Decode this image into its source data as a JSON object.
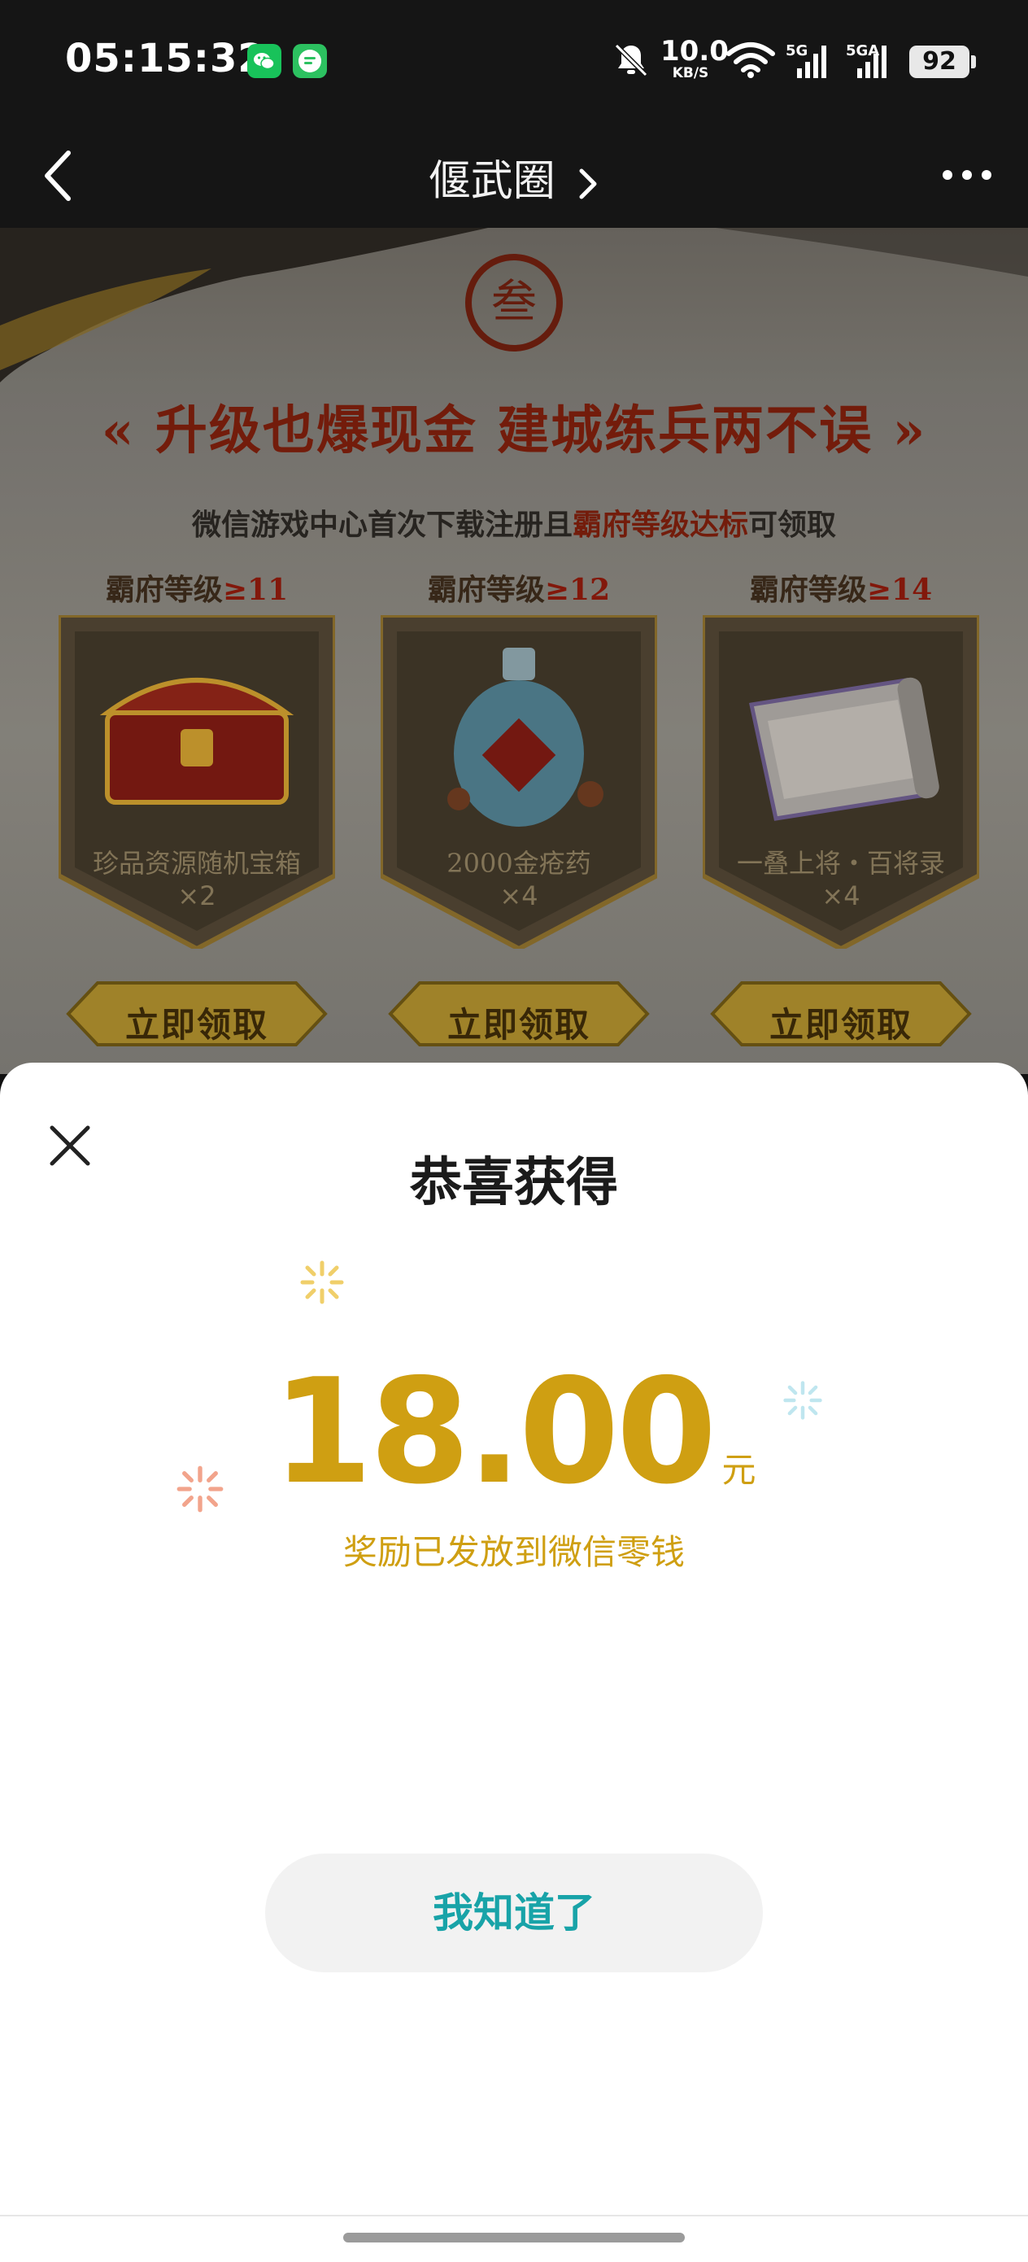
{
  "status_bar": {
    "time": "05:15:32",
    "net_speed_value": "10.0",
    "net_speed_unit": "KB/S",
    "signal_1_label": "5G",
    "signal_2_label": "5GA",
    "battery": "92",
    "icons": [
      "wechat-icon",
      "message-icon",
      "mute-bell-icon",
      "wifi-icon",
      "signal-icon",
      "signal-icon",
      "battery-icon"
    ]
  },
  "nav": {
    "title": "偃武圈",
    "icons": [
      "back-chevron-icon",
      "forward-chevron-icon",
      "more-dots-icon"
    ]
  },
  "promo": {
    "seal": "叁",
    "headline": "升级也爆现金 建城练兵两不误",
    "sub_prefix": "微信游戏中心首次下载注册且",
    "sub_highlight": "霸府等级达标",
    "sub_suffix": "可领取",
    "rewards": [
      {
        "level_label": "霸府等级",
        "level_value": "≥11",
        "name": "珍品资源随机宝箱",
        "qty": "×2",
        "claim": "立即领取",
        "icon": "treasure-chest-icon"
      },
      {
        "level_label": "霸府等级",
        "level_value": "≥12",
        "name": "2000金疮药",
        "qty": "×4",
        "claim": "立即领取",
        "icon": "medicine-bottle-icon"
      },
      {
        "level_label": "霸府等级",
        "level_value": "≥14",
        "name": "一叠上将・百将录",
        "qty": "×4",
        "claim": "立即领取",
        "icon": "scroll-icon"
      }
    ]
  },
  "sheet": {
    "title": "恭喜获得",
    "amount": "18.00",
    "unit": "元",
    "note": "奖励已发放到微信零钱",
    "button": "我知道了",
    "colors": {
      "gold": "#cf9f12",
      "teal": "#18a3a8"
    }
  }
}
